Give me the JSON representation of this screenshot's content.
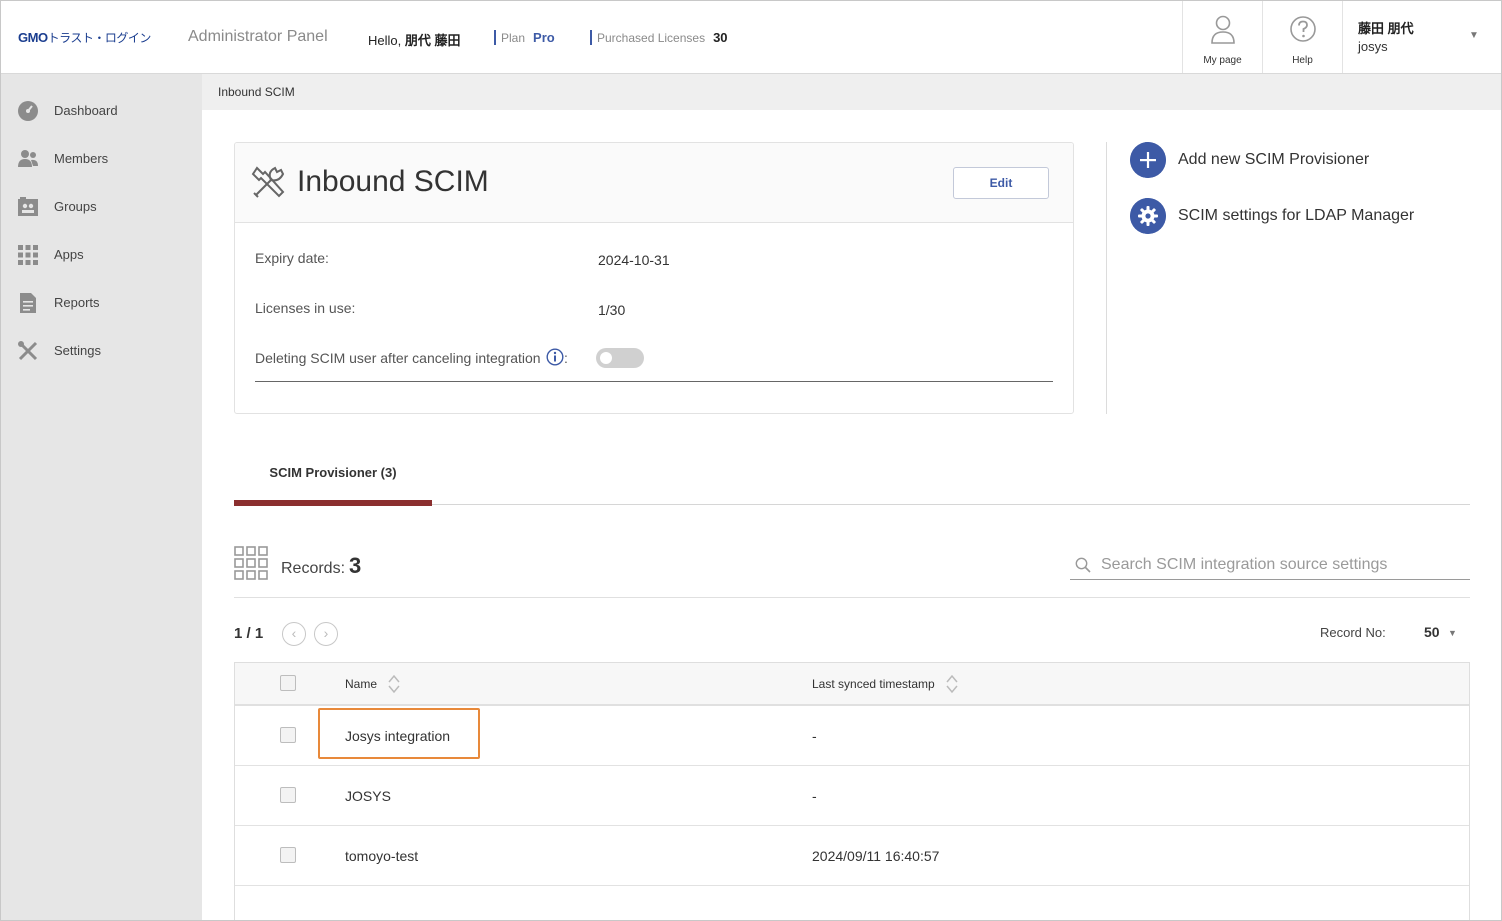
{
  "header": {
    "logo_brand": "GMO",
    "logo_rest": "トラスト・ログイン",
    "panel_title": "Administrator Panel",
    "hello_prefix": "Hello, ",
    "hello_name": "朋代 藤田",
    "plan_label": "Plan",
    "plan_value": "Pro",
    "licenses_label": "Purchased Licenses",
    "licenses_value": "30",
    "mypage_label": "My page",
    "help_label": "Help",
    "user_name": "藤田 朋代",
    "user_org": "josys",
    "user_caret": "▼"
  },
  "sidebar": {
    "items": [
      {
        "label": "Dashboard",
        "icon": "gauge-icon"
      },
      {
        "label": "Members",
        "icon": "members-icon"
      },
      {
        "label": "Groups",
        "icon": "groups-icon"
      },
      {
        "label": "Apps",
        "icon": "apps-grid-icon"
      },
      {
        "label": "Reports",
        "icon": "report-icon"
      },
      {
        "label": "Settings",
        "icon": "tools-icon"
      }
    ]
  },
  "breadcrumb": "Inbound SCIM",
  "card": {
    "title": "Inbound SCIM",
    "edit_label": "Edit",
    "expiry_label": "Expiry date:",
    "expiry_value": "2024-10-31",
    "licenses_label": "Licenses in use:",
    "licenses_value": "1/30",
    "delete_label": "Deleting SCIM user after canceling integration",
    "delete_colon": ":",
    "delete_enabled": false
  },
  "actions": {
    "add_label": "Add new SCIM Provisioner",
    "ldap_label": "SCIM settings for LDAP Manager"
  },
  "tabs": [
    {
      "label": "SCIM Provisioner (3)",
      "active": true
    }
  ],
  "records": {
    "label": "Records:",
    "count": "3",
    "search_placeholder": "Search SCIM integration source settings",
    "page": "1 / 1",
    "prev": "‹",
    "next": "›",
    "record_no_label": "Record No:",
    "record_no_value": "50",
    "record_no_caret": "▼"
  },
  "table": {
    "columns": [
      "Name",
      "Last synced timestamp"
    ],
    "rows": [
      {
        "name": "Josys integration",
        "timestamp": "-"
      },
      {
        "name": "JOSYS",
        "timestamp": "-"
      },
      {
        "name": "tomoyo-test",
        "timestamp": "2024/09/11 16:40:57"
      }
    ]
  },
  "colors": {
    "accent": "#3d5aa6",
    "tab_active": "#8b2f2f",
    "highlight": "#e8893a",
    "sidebar_bg": "#e6e6e6"
  }
}
